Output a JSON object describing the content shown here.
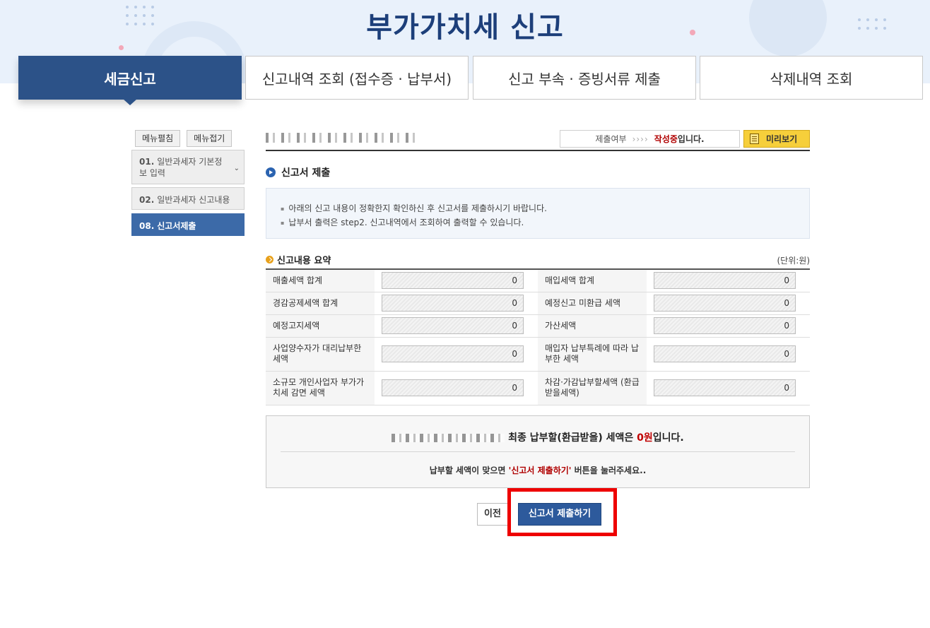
{
  "header": {
    "title": "부가가치세 신고"
  },
  "tabs": [
    {
      "label": "세금신고",
      "active": true
    },
    {
      "label": "신고내역 조회 (접수증 · 납부서)",
      "active": false
    },
    {
      "label": "신고 부속 · 증빙서류 제출",
      "active": false
    },
    {
      "label": "삭제내역 조회",
      "active": false
    }
  ],
  "sidebar": {
    "expand_label": "메뉴펼침",
    "collapse_label": "메뉴접기",
    "items": [
      {
        "num": "01.",
        "label": "일반과세자 기본정보 입력"
      },
      {
        "num": "02.",
        "label": "일반과세자 신고내용"
      },
      {
        "num": "08.",
        "label": "신고서제출"
      }
    ]
  },
  "status": {
    "label": "제출여부",
    "arrows": "››››",
    "state": "작성중",
    "state_suffix": "입니다.",
    "preview_label": "미리보기"
  },
  "section": {
    "title": "신고서 제출",
    "notices": [
      "아래의 신고 내용이 정확한지 확인하신 후 신고서를 제출하시기 바랍니다.",
      "납부서 출력은 step2. 신고내역에서 조회하여 출력할 수 있습니다."
    ]
  },
  "summary": {
    "title": "신고내용 요약",
    "unit": "(단위:원)",
    "rows": [
      [
        {
          "label": "매출세액 합계",
          "value": "0"
        },
        {
          "label": "매입세액 합계",
          "value": "0"
        }
      ],
      [
        {
          "label": "경감공제세액 합계",
          "value": "0"
        },
        {
          "label": "예정신고 미환급 세액",
          "value": "0"
        }
      ],
      [
        {
          "label": "예정고지세액",
          "value": "0"
        },
        {
          "label": "가산세액",
          "value": "0"
        }
      ],
      [
        {
          "label": "사업양수자가 대리납부한 세액",
          "value": "0"
        },
        {
          "label": "매입자 납부특례에 따라 납부한 세액",
          "value": "0"
        }
      ],
      [
        {
          "label": "소규모 개인사업자 부가가치세 감면 세액",
          "value": "0"
        },
        {
          "label": "차감·가감납부할세액 (환급받을세액)",
          "value": "0"
        }
      ]
    ]
  },
  "final": {
    "prefix": "최종 납부할(환급받을) 세액은",
    "amount": "0원",
    "suffix": "입니다.",
    "sub_prefix": "납부할 세액이 맞으면",
    "sub_highlight": "'신고서 제출하기'",
    "sub_suffix": "버튼을 눌러주세요.."
  },
  "buttons": {
    "prev_label": "이전",
    "submit_label": "신고서 제출하기"
  },
  "colors": {
    "brand_navy": "#1d3f7a",
    "tab_active": "#2c5288",
    "submit": "#2d5a9c",
    "highlight": "#ee0000",
    "preview": "#f6cf3b"
  }
}
